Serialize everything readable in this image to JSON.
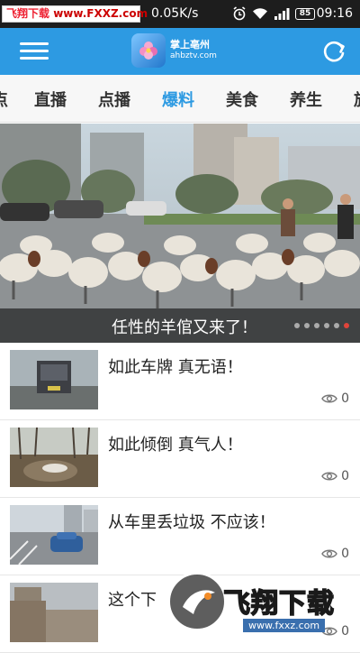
{
  "status_bar": {
    "badge_text": "飞翔下载",
    "badge_url": "www.FXXZ.com",
    "speed": "0.05K/s",
    "battery": "85",
    "time": "09:16"
  },
  "app_bar": {
    "logo_title": "掌上亳州",
    "logo_url": "ahbztv.com"
  },
  "tabs": [
    {
      "label": "点"
    },
    {
      "label": "直播"
    },
    {
      "label": "点播"
    },
    {
      "label": "爆料"
    },
    {
      "label": "美食"
    },
    {
      "label": "养生"
    },
    {
      "label": "旅"
    }
  ],
  "banner": {
    "title": "任性的羊倌又来了！",
    "slides": 6,
    "current_slide": 6
  },
  "news": [
    {
      "title": "如此车牌 真无语！",
      "views": "0"
    },
    {
      "title": "如此倾倒 真气人！",
      "views": "0"
    },
    {
      "title": "从车里丢垃圾 不应该！",
      "views": "0"
    },
    {
      "title": "这个下",
      "views": "0"
    }
  ],
  "watermark": {
    "brand": "飞翔下载",
    "url": "www.fxxz.com"
  },
  "colors": {
    "brand_blue": "#2d9ae2",
    "status_bar": "#1d1d1d",
    "active_dot": "#e0443a"
  }
}
